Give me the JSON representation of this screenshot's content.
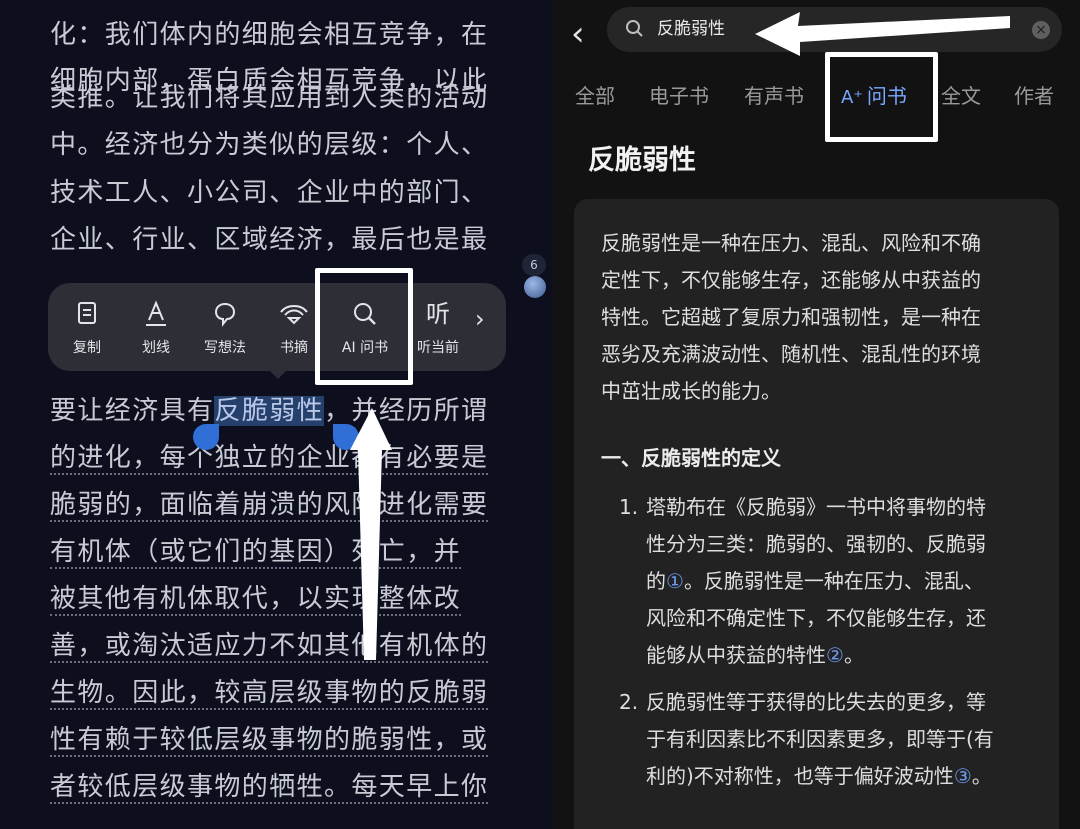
{
  "reader": {
    "lines": [
      "化：我们体内的细胞会相互竞争，在",
      "细胞内部，蛋白质会相互竞争，以此",
      "类推。让我们将其应用到人类的活动",
      "中。经济也分为类似的层级：个人、",
      "技术工人、小公司、企业中的部门、",
      "企业、行业、区域经济，最后也是最"
    ],
    "selection_line": {
      "before": "要让经济具有",
      "selected": "反脆弱性",
      "after": "，并经历所谓"
    },
    "dotted_lines": [
      "的进化，每个独立的企业都有必要是",
      "脆弱的，面临着崩溃的风险进化需要",
      "有机体（或它们的基因）死亡，并",
      "被其他有机体取代，以实现整体改",
      "善，或淘汰适应力不如其他有机体的",
      "生物。因此，较高层级事物的反脆弱",
      "性有赖于较低层级事物的脆弱性，或",
      "者较低层级事物的牺牲。每天早上你"
    ],
    "side_badge": "6"
  },
  "popup": {
    "items": [
      {
        "label": "复制",
        "icon": "copy-icon"
      },
      {
        "label": "划线",
        "icon": "underline-icon"
      },
      {
        "label": "写想法",
        "icon": "thought-bubble-icon"
      },
      {
        "label": "书摘",
        "icon": "excerpt-icon"
      },
      {
        "label": "AI 问书",
        "icon": "search-icon"
      },
      {
        "label": "听当前",
        "icon": "listen-icon",
        "glyph": "听"
      }
    ]
  },
  "search": {
    "query": "反脆弱性"
  },
  "tabs": [
    {
      "label": "全部",
      "active": false
    },
    {
      "label": "电子书",
      "active": false
    },
    {
      "label": "有声书",
      "active": false
    },
    {
      "label": "问书",
      "prefix": "A⁺",
      "active": true
    },
    {
      "label": "全文",
      "active": false
    },
    {
      "label": "作者",
      "active": false
    }
  ],
  "result": {
    "title": "反脆弱性",
    "intro_lines": [
      "反脆弱性是一种在压力、混乱、风险和不确",
      "定性下，不仅能够生存，还能够从中获益的",
      "特性。它超越了复原力和强韧性，是一种在",
      "恶劣及充满波动性、随机性、混乱性的环境",
      "中茁壮成长的能力。"
    ],
    "section_heading": "一、反脆弱性的定义",
    "items": [
      {
        "num": "1.",
        "lines": [
          "塔勒布在《反脆弱》一书中将事物的特",
          "性分为三类：脆弱的、强韧的、反脆弱",
          "的①。反脆弱性是一种在压力、混乱、",
          "风险和不确定性下，不仅能够生存，还",
          "能够从中获益的特性②。"
        ]
      },
      {
        "num": "2.",
        "lines": [
          "反脆弱性等于获得的比失去的更多，等",
          "于有利因素比不利因素更多，即等于(有",
          "利的)不对称性，也等于偏好波动性③。"
        ]
      }
    ]
  },
  "colors": {
    "accent": "#7aa6ff",
    "highlight": "#24406b",
    "handle": "#2f6fd6",
    "annotation": "#ffffff"
  }
}
